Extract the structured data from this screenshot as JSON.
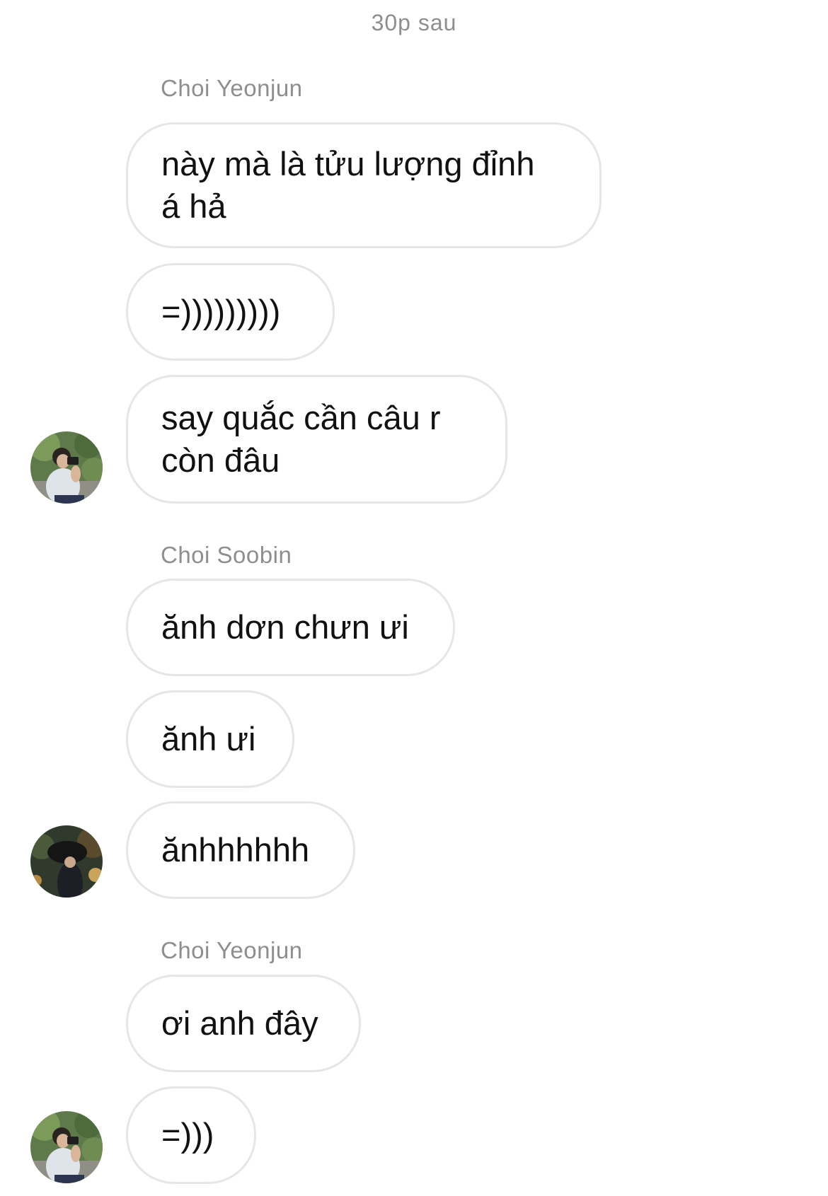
{
  "time_separator": "30p sau",
  "groups": [
    {
      "sender": "Choi Yeonjun",
      "messages": [
        "này mà là tửu lượng đỉnh\ná hả",
        "=)))))))))",
        "say quắc cần câu r\ncòn đâu"
      ],
      "avatar_icon": "avatar-photo-icon"
    },
    {
      "sender": "Choi Soobin",
      "messages": [
        "ănh dơn chưn ưi",
        "ănh ưi",
        "ănhhhhhh"
      ],
      "avatar_icon": "avatar-photo-icon"
    },
    {
      "sender": "Choi Yeonjun",
      "messages": [
        "ơi anh đây",
        "=)))"
      ],
      "avatar_icon": "avatar-photo-icon"
    }
  ],
  "colors": {
    "bubble_border": "#e6e6e6",
    "muted_text": "#8e8e8e",
    "message_text": "#111111"
  }
}
